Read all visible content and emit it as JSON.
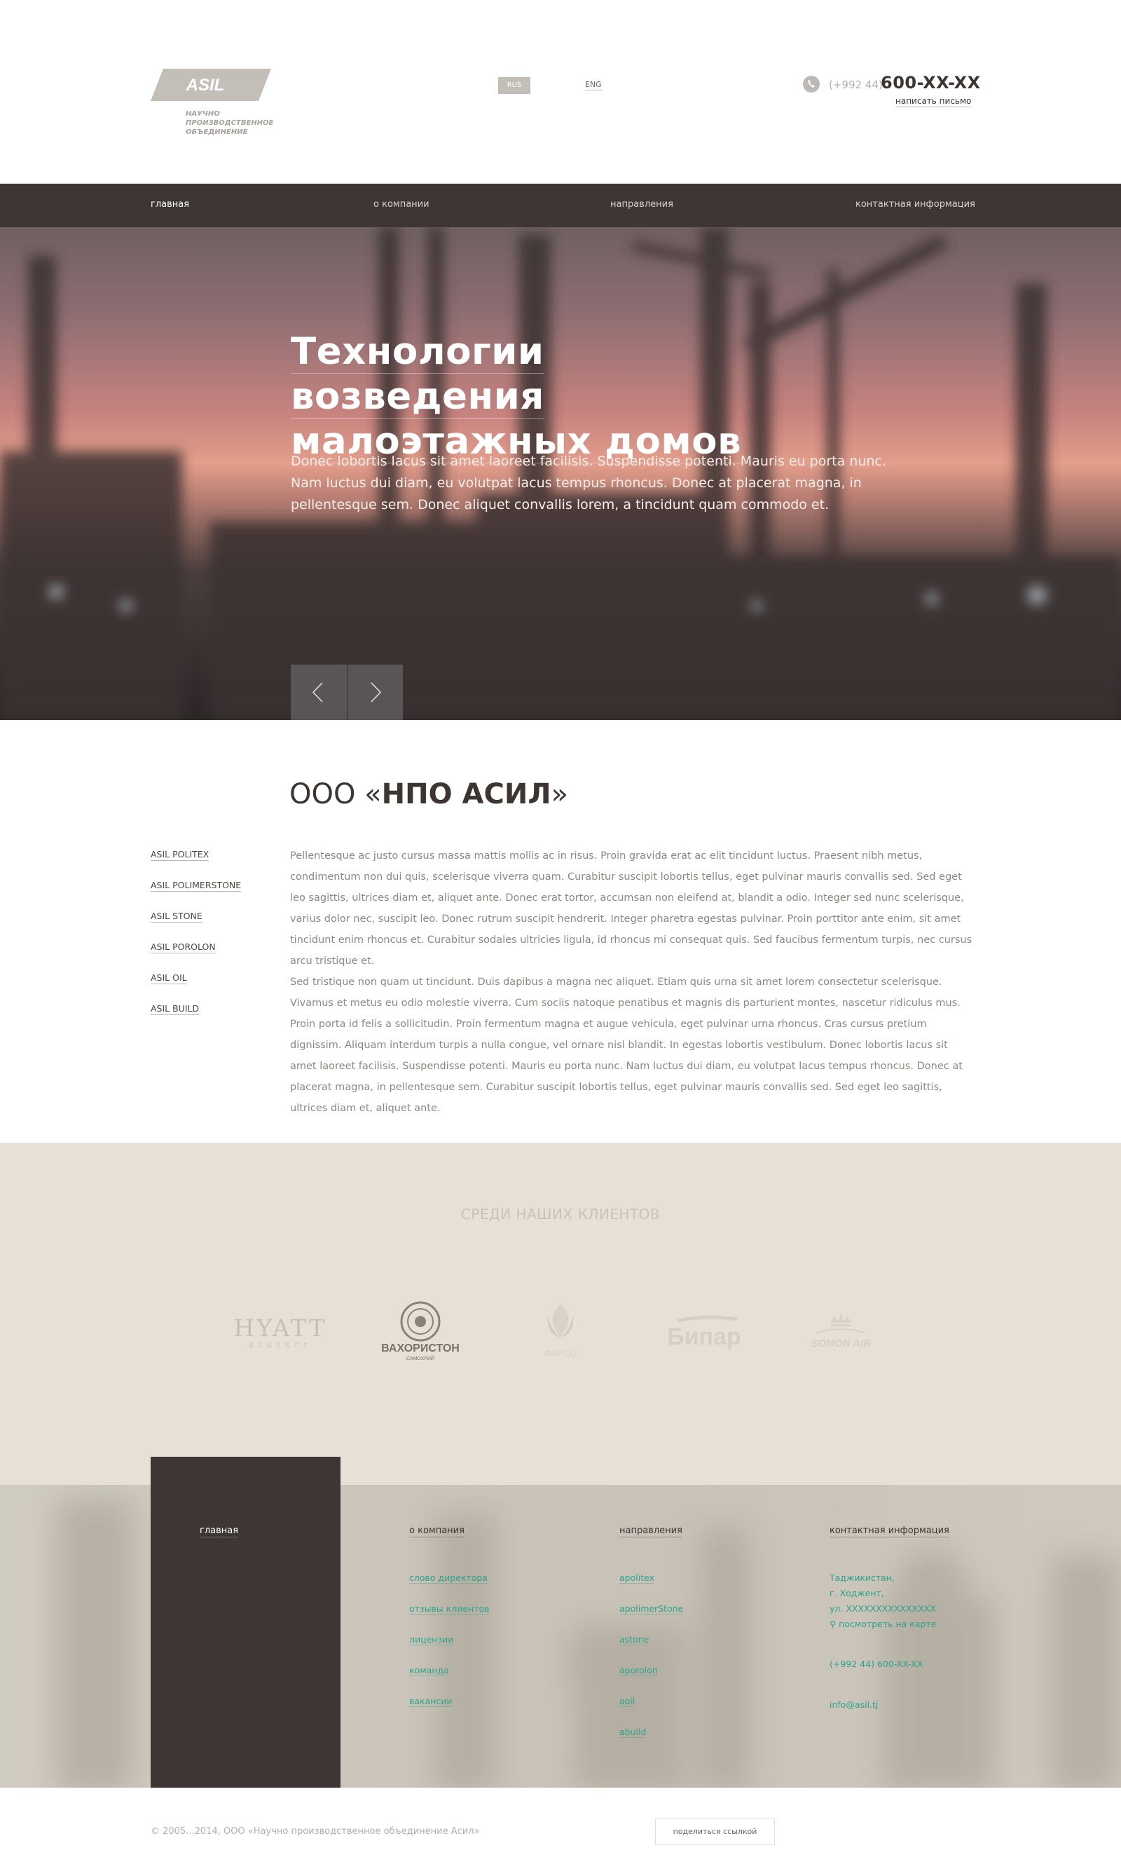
{
  "header": {
    "logo_text": "ASIL",
    "tagline": "НАУЧНО ПРОИЗВОДСТВЕННОЕ ОБЪЕДИНЕНИЕ",
    "lang": {
      "rus": "RUS",
      "eng": "ENG"
    },
    "phone_prefix": "(+992 44)",
    "phone_number": "600-XX-XX",
    "write_link": "написать письмо"
  },
  "nav": {
    "items": [
      "главная",
      "о компании",
      "направления",
      "контактная информация"
    ],
    "active_index": 0
  },
  "hero": {
    "title_line1": "Технологии возведения",
    "title_line2": "малоэтажных домов",
    "text": "Donec lobortis lacus sit amet laoreet facilisis. Suspendisse potenti. Mauris eu porta nunc. Nam luctus dui diam, eu volutpat lacus tempus rhoncus. Donec at placerat magna, in pellentesque sem. Donec aliquet convallis lorem, a tincidunt quam commodo et."
  },
  "about": {
    "title_prefix": "ООО «",
    "title_name": "НПО АСИЛ",
    "title_suffix": "»",
    "side_links": [
      "ASIL POLITEX",
      "ASIL POLIMERSTONE",
      "ASIL STONE",
      "ASIL POROLON",
      "ASIL OIL",
      "ASIL BUILD"
    ],
    "text": "Pellentesque ac justo cursus massa mattis mollis ac in risus. Proin gravida erat ac elit tincidunt luctus. Praesent nibh metus, condimentum non dui quis, scelerisque viverra quam. Curabitur suscipit lobortis tellus, eget pulvinar mauris convallis sed. Sed eget leo sagittis, ultrices diam et, aliquet ante. Donec erat tortor, accumsan non eleifend at, blandit a odio. Integer sed nunc scelerisque, varius dolor nec, suscipit leo. Donec rutrum suscipit hendrerit. Integer pharetra egestas pulvinar. Proin porttitor ante enim, sit amet tincidunt enim rhoncus et. Curabitur sodales ultricies ligula, id rhoncus mi consequat quis. Sed faucibus fermentum turpis, nec cursus arcu tristique et.",
    "text2": "Sed tristique non quam ut tincidunt. Duis dapibus a magna nec aliquet. Etiam quis urna sit amet lorem consectetur scelerisque. Vivamus et metus eu odio molestie viverra. Cum sociis natoque penatibus et magnis dis parturient montes, nascetur ridiculus mus. Proin porta id felis a sollicitudin. Proin fermentum magna et augue vehicula, eget pulvinar urna rhoncus. Cras cursus pretium dignissim. Aliquam interdum turpis a nulla congue, vel ornare nisl blandit. In egestas lobortis vestibulum. Donec lobortis lacus sit amet laoreet facilisis. Suspendisse potenti. Mauris eu porta nunc. Nam luctus dui diam, eu volutpat lacus tempus rhoncus. Donec at placerat magna, in pellentesque sem. Curabitur suscipit lobortis tellus, eget pulvinar mauris convallis sed. Sed eget leo sagittis, ultrices diam et, aliquet ante."
  },
  "clients": {
    "title": "СРЕДИ НАШИХ КЛИЕНТОВ",
    "logos": [
      {
        "name": "HYATT",
        "sub": "REGENCY"
      },
      {
        "name": "ВАХОРИСТОН",
        "sub": "САМОХРИЙ"
      },
      {
        "name": "ФАРОЗ"
      },
      {
        "name": "Бипар"
      },
      {
        "name": "SOMON AIR"
      }
    ]
  },
  "footer": {
    "col_main": "главная",
    "col_company": {
      "title": "о компания",
      "links": [
        "слово директора",
        "отзывы клиентов",
        "лицензии",
        "команда",
        "вакансии"
      ]
    },
    "col_directions": {
      "title": "направления",
      "links": [
        "apolitex",
        "apolimerStone",
        "astone",
        "aporolon",
        "aoil",
        "abuild"
      ]
    },
    "col_contacts": {
      "title": "контактная информация",
      "address1": "Таджикистан,",
      "address2": "г. Ходжент,",
      "address3": "ул. XXXXXXXXXXXXXXX",
      "map_link": "посмотреть на карте",
      "phone": "(+992 44) 600-XX-XX",
      "email": "info@asil.tj"
    },
    "copyright": "© 2005...2014, ООО «Научно производственное объединение Асил»",
    "share": "поделиться ссылкой"
  },
  "colors": {
    "dark": "#3d3634",
    "accent": "#2aa58b",
    "beige": "#e6e0d6",
    "logo_grey": "#c3beb8"
  }
}
